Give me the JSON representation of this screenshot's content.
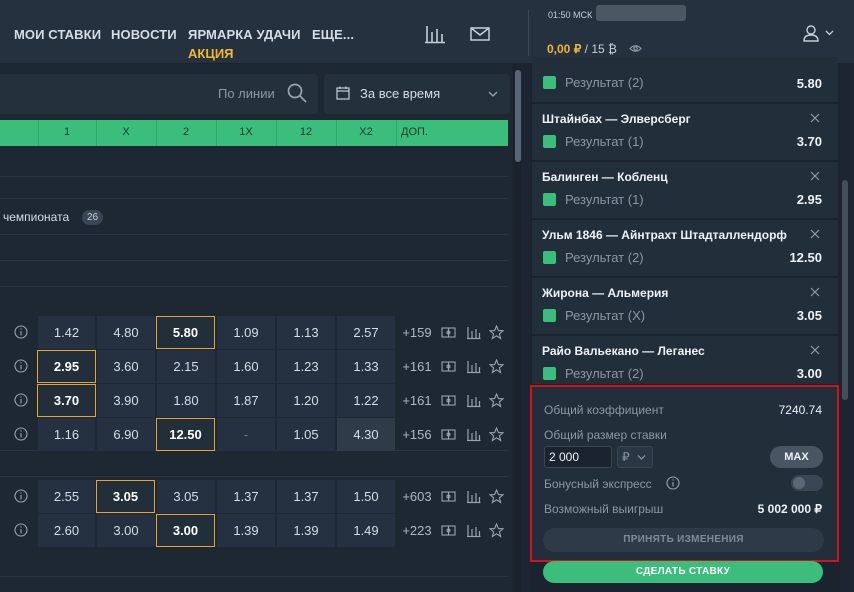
{
  "nav": {
    "items": [
      "МОИ СТАВКИ",
      "НОВОСТИ",
      "ЯРМАРКА УДАЧИ",
      "ЕЩЕ..."
    ],
    "promo": "АКЦИЯ"
  },
  "account": {
    "clock": "01:50 МСК",
    "balance": "0,00 ₽",
    "bonus": "15 ₿"
  },
  "search": {
    "placeholder": "По линии"
  },
  "period": {
    "label": "За все время"
  },
  "columns": [
    "1",
    "X",
    "2",
    "1X",
    "12",
    "X2",
    "ДОП."
  ],
  "championship": {
    "label": "чемпионата",
    "count": "26"
  },
  "matches": [
    {
      "odds": [
        "1.42",
        "4.80",
        "5.80",
        "1.09",
        "1.13",
        "2.57"
      ],
      "more": "+159"
    },
    {
      "odds": [
        "2.95",
        "3.60",
        "2.15",
        "1.60",
        "1.23",
        "1.33"
      ],
      "more": "+161"
    },
    {
      "odds": [
        "3.70",
        "3.90",
        "1.80",
        "1.87",
        "1.20",
        "1.22"
      ],
      "more": "+161"
    },
    {
      "odds": [
        "1.16",
        "6.90",
        "12.50",
        "-",
        "1.05",
        "4.30"
      ],
      "more": "+156"
    },
    {
      "odds": [
        "2.55",
        "3.05",
        "3.05",
        "1.37",
        "1.37",
        "1.50"
      ],
      "more": "+603"
    },
    {
      "odds": [
        "2.60",
        "3.00",
        "3.00",
        "1.39",
        "1.39",
        "1.49"
      ],
      "more": "+223"
    }
  ],
  "coupon": {
    "bets": [
      {
        "title": "",
        "result": "Результат (2)",
        "odd": "5.80"
      },
      {
        "title": "Штайнбах — Элверсберг",
        "result": "Результат (1)",
        "odd": "3.70"
      },
      {
        "title": "Балинген — Кобленц",
        "result": "Результат (1)",
        "odd": "2.95"
      },
      {
        "title": "Ульм 1846 — Айнтрахт Штадталлендорф",
        "result": "Результат (2)",
        "odd": "12.50"
      },
      {
        "title": "Жирона — Альмерия",
        "result": "Результат (X)",
        "odd": "3.05"
      },
      {
        "title": "Райо Вальекано — Леганес",
        "result": "Результат (2)",
        "odd": "3.00"
      }
    ],
    "total_odds_label": "Общий коэффициент",
    "total_odds": "7240.74",
    "stake_label": "Общий размер ставки",
    "stake_value": "2 000",
    "currency": "₽",
    "max_label": "MAX",
    "bonus_label": "Бонусный экспресс",
    "win_label": "Возможный выигрыш",
    "win_value": "5 002 000 ₽",
    "accept_label": "ПРИНЯТЬ ИЗМЕНЕНИЯ",
    "place_label": "СДЕЛАТЬ СТАВКУ"
  },
  "colors": {
    "accent_green": "#3bbd7c",
    "accent_yellow": "#f1b733",
    "highlight_red": "#d1141b"
  }
}
